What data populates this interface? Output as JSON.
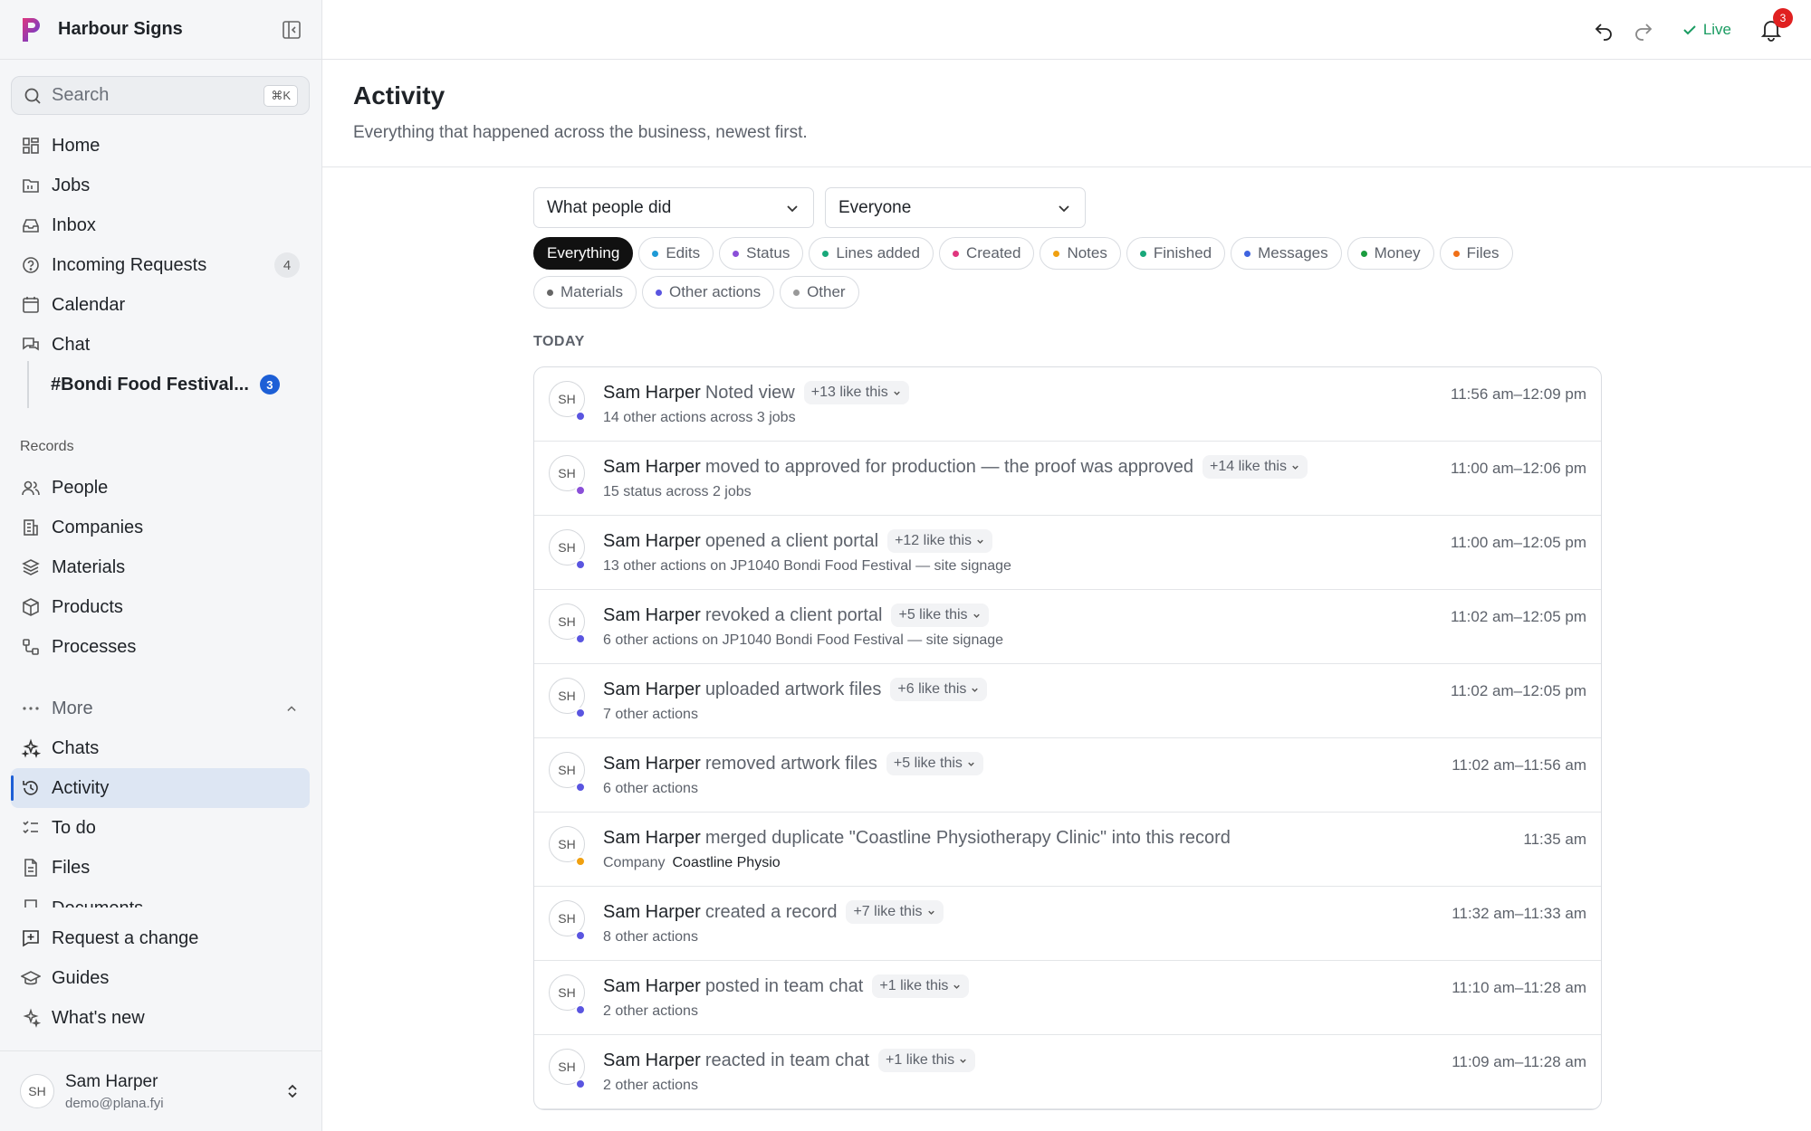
{
  "brand": {
    "name": "Harbour Signs"
  },
  "search": {
    "placeholder": "Search",
    "shortcut": "⌘K"
  },
  "nav": {
    "home": "Home",
    "jobs": "Jobs",
    "inbox": "Inbox",
    "incoming": "Incoming Requests",
    "incoming_count": "4",
    "calendar": "Calendar",
    "chat": "Chat",
    "chat_channel": "#Bondi Food Festival...",
    "chat_channel_badge": "3"
  },
  "records": {
    "label": "Records",
    "people": "People",
    "companies": "Companies",
    "materials": "Materials",
    "products": "Products",
    "processes": "Processes"
  },
  "more": {
    "label": "More",
    "chats": "Chats",
    "activity": "Activity",
    "todo": "To do",
    "files": "Files",
    "documents": "Documents"
  },
  "footer_nav": {
    "request": "Request a change",
    "guides": "Guides",
    "whatsnew": "What's new"
  },
  "user": {
    "initials": "SH",
    "name": "Sam Harper",
    "email": "demo@plana.fyi"
  },
  "topbar": {
    "live": "Live",
    "notifications": "3"
  },
  "page": {
    "title": "Activity",
    "subtitle": "Everything that happened across the business, newest first."
  },
  "filters": {
    "action": "What people did",
    "people": "Everyone"
  },
  "chips": [
    {
      "label": "Everything",
      "color": "",
      "selected": true
    },
    {
      "label": "Edits",
      "color": "#1f9ad6"
    },
    {
      "label": "Status",
      "color": "#8a4fd8"
    },
    {
      "label": "Lines added",
      "color": "#18a87a"
    },
    {
      "label": "Created",
      "color": "#e0367e"
    },
    {
      "label": "Notes",
      "color": "#f0a010"
    },
    {
      "label": "Finished",
      "color": "#18a87a"
    },
    {
      "label": "Messages",
      "color": "#3f64e0"
    },
    {
      "label": "Money",
      "color": "#1a9c3e"
    },
    {
      "label": "Files",
      "color": "#f07018"
    },
    {
      "label": "Materials",
      "color": "#666666"
    },
    {
      "label": "Other actions",
      "color": "#5a55e0"
    },
    {
      "label": "Other",
      "color": "#999999"
    }
  ],
  "group": "TODAY",
  "activity": [
    {
      "who": "Sam Harper",
      "what": "Noted view",
      "like": "+13 like this",
      "sub": "14 other actions across 3 jobs",
      "sub_value": "",
      "time": "11:56 am–12:09 pm",
      "dot": "#5a55e0"
    },
    {
      "who": "Sam Harper",
      "what": "moved to approved for production — the proof was approved",
      "like": "+14 like this",
      "sub": "15 status across 2 jobs",
      "sub_value": "",
      "time": "11:00 am–12:06 pm",
      "dot": "#8a4fd8"
    },
    {
      "who": "Sam Harper",
      "what": "opened a client portal",
      "like": "+12 like this",
      "sub": "13 other actions on JP1040 Bondi Food Festival — site signage",
      "sub_value": "",
      "time": "11:00 am–12:05 pm",
      "dot": "#5a55e0"
    },
    {
      "who": "Sam Harper",
      "what": "revoked a client portal",
      "like": "+5 like this",
      "sub": "6 other actions on JP1040 Bondi Food Festival — site signage",
      "sub_value": "",
      "time": "11:02 am–12:05 pm",
      "dot": "#5a55e0"
    },
    {
      "who": "Sam Harper",
      "what": "uploaded artwork files",
      "like": "+6 like this",
      "sub": "7 other actions",
      "sub_value": "",
      "time": "11:02 am–12:05 pm",
      "dot": "#5a55e0"
    },
    {
      "who": "Sam Harper",
      "what": "removed artwork files",
      "like": "+5 like this",
      "sub": "6 other actions",
      "sub_value": "",
      "time": "11:02 am–11:56 am",
      "dot": "#5a55e0"
    },
    {
      "who": "Sam Harper",
      "what": "merged duplicate \"Coastline Physiotherapy Clinic\" into this record",
      "like": "",
      "sub": "Company",
      "sub_value": "Coastline Physio",
      "time": "11:35 am",
      "dot": "#f0a010"
    },
    {
      "who": "Sam Harper",
      "what": "created a record",
      "like": "+7 like this",
      "sub": "8 other actions",
      "sub_value": "",
      "time": "11:32 am–11:33 am",
      "dot": "#5a55e0"
    },
    {
      "who": "Sam Harper",
      "what": "posted in team chat",
      "like": "+1 like this",
      "sub": "2 other actions",
      "sub_value": "",
      "time": "11:10 am–11:28 am",
      "dot": "#5a55e0"
    },
    {
      "who": "Sam Harper",
      "what": "reacted in team chat",
      "like": "+1 like this",
      "sub": "2 other actions",
      "sub_value": "",
      "time": "11:09 am–11:28 am",
      "dot": "#5a55e0"
    }
  ]
}
